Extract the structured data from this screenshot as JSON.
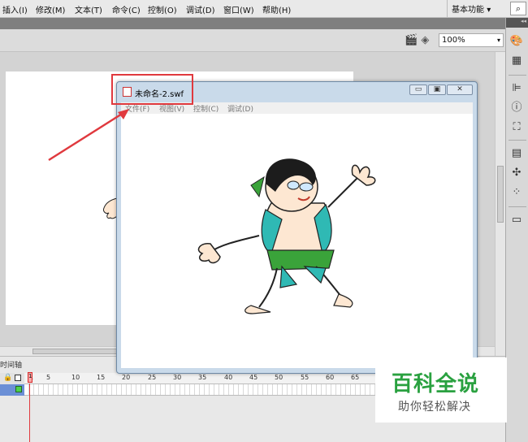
{
  "menubar": {
    "items": [
      "插入(I)",
      "修改(M)",
      "文本(T)",
      "命令(C)",
      "控制(O)",
      "调试(D)",
      "窗口(W)",
      "帮助(H)"
    ],
    "workspace": "基本功能",
    "workspace_caret": "▾",
    "search_icon": "⌕"
  },
  "toolbar": {
    "zoom": "100%",
    "zoom_caret": "▾",
    "icons": [
      "scene-icon",
      "symbol-icon"
    ]
  },
  "swf_window": {
    "title": "未命名-2.swf",
    "menus": [
      "文件(F)",
      "视图(V)",
      "控制(C)",
      "调试(D)"
    ],
    "controls": [
      "▭",
      "▣",
      "✕"
    ]
  },
  "timeline": {
    "label": "时间轴",
    "frame_numbers": [
      "1",
      "5",
      "10",
      "15",
      "20",
      "25",
      "30",
      "35",
      "40",
      "45",
      "50",
      "55",
      "60",
      "65"
    ],
    "playhead_frame": "1"
  },
  "right_panel": {
    "collapse": "◂◂",
    "icons": [
      "color-swatch-icon",
      "grid-icon",
      "align-icon",
      "info-icon",
      "transform-icon",
      "library-icon",
      "components-icon",
      "motion-icon",
      "project-icon"
    ]
  },
  "watermark": {
    "title": "百科全说",
    "subtitle": "助你轻松解决"
  },
  "colors": {
    "highlight": "#e0393e",
    "watermark_green": "#2aa140"
  }
}
